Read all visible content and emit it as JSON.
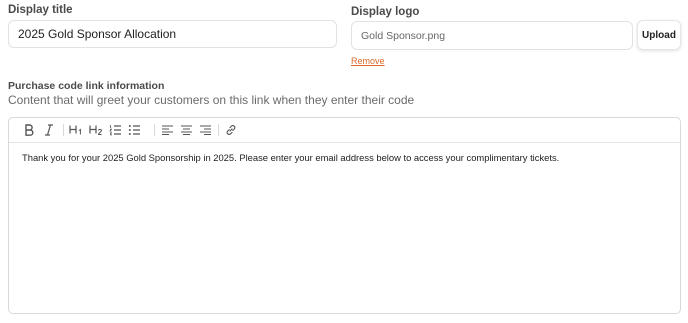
{
  "display_title": {
    "label": "Display title",
    "value": "2025 Gold Sponsor Allocation"
  },
  "display_logo": {
    "label": "Display logo",
    "file_name": "Gold Sponsor.png",
    "upload_label": "Upload",
    "remove_label": "Remove"
  },
  "purchase_code": {
    "label": "Purchase code link information",
    "help_text": "Content that will greet your customers on this link when they enter their code"
  },
  "editor": {
    "toolbar_icons": [
      "bold-icon",
      "italic-icon",
      "heading-1-icon",
      "heading-2-icon",
      "ordered-list-icon",
      "bullet-list-icon",
      "align-left-icon",
      "align-center-icon",
      "align-right-icon",
      "link-icon"
    ],
    "content": "Thank you for your 2025 Gold Sponsorship in 2025. Please enter your email address below to access your complimentary tickets."
  },
  "colors": {
    "remove_link": "#d96b2b",
    "border": "#e2e2e2"
  }
}
